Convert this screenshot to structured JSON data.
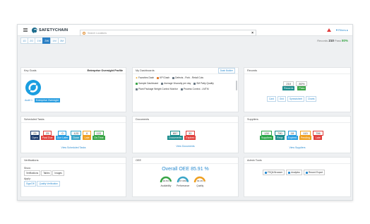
{
  "topbar": {
    "logo_text": "SAFETYCHAIN",
    "filters_label": "▼Filters ▸"
  },
  "ranges": [
    "1D",
    "2D",
    "1W",
    "2W",
    "1M",
    "3M"
  ],
  "active_range_index": 3,
  "records_summary": {
    "label": "Records",
    "count": "210",
    "pass_label": "Pass",
    "pass_value": "80%"
  },
  "search": {
    "placeholder": "Search Locations",
    "close_label": "×"
  },
  "key_goals": {
    "title": "Key Goals",
    "profile": "Enterprise Oversight Profile",
    "audit_label": "Audit 1",
    "badge_label": "Enterprise Oversight"
  },
  "dashboards": {
    "title": "My Dashboards",
    "open_builder": "Dash Builder",
    "items": [
      {
        "label": "Favorites Dash",
        "icon": "star-icon",
        "color": "#e8a21a"
      },
      {
        "label": "KPI Dash",
        "icon": "chart-icon",
        "color": "#e57b2c"
      },
      {
        "label": "Defects - Pork - Retail Cuts",
        "icon": "grid-icon",
        "color": "#6b7a86"
      },
      {
        "label": "Sample Dashboard",
        "icon": "grid-icon",
        "color": "#3aa648"
      },
      {
        "label": "Average Viscosity per day",
        "icon": "grid-icon",
        "color": "#6b7a86"
      },
      {
        "label": "SM Patty Quality",
        "icon": "grid-icon",
        "color": "#6b7a86"
      },
      {
        "label": "Plant Package Weight Control Monitor",
        "icon": "grid-icon",
        "color": "#6b7a86"
      },
      {
        "label": "Process Control - LMTM",
        "icon": "grid-icon",
        "color": "#6b7a86"
      }
    ]
  },
  "records": {
    "title": "Records",
    "count": "210",
    "pass_pct": "80%",
    "count_label": "Records",
    "pass_label": "Pass",
    "actions": [
      "Card",
      "Grid",
      "Spreadsheet",
      "Charts"
    ]
  },
  "scheduled_tasks": {
    "title": "Scheduled Tasks",
    "tiles": [
      {
        "value": "25",
        "label": "Open",
        "color": "#1d3c6e"
      },
      {
        "value": "25",
        "label": "Past Due",
        "color": "#e0403c"
      },
      {
        "value": "0",
        "label": "Due Later",
        "color": "#2a9ee0"
      },
      {
        "value": "123",
        "label": "Done",
        "color": "#3aa6c8"
      },
      {
        "value": "0",
        "label": "Late",
        "color": "#f0a020"
      },
      {
        "value": "122",
        "label": "On Time",
        "color": "#3aa648"
      }
    ],
    "view_link": "View Scheduled Tasks"
  },
  "documents": {
    "title": "Documents",
    "tiles": [
      {
        "value": "857",
        "label": "Documents",
        "color": "#1a8c8c"
      },
      {
        "value": "32",
        "label": "Expired",
        "color": "#e0403c"
      }
    ],
    "view_link": "View Documents"
  },
  "suppliers": {
    "title": "Suppliers",
    "tiles": [
      {
        "value": "130",
        "label": "Suppliers",
        "color": "#2aa648"
      },
      {
        "value": "790",
        "label": "Reqs",
        "color": "#1a8c8c"
      },
      {
        "value": "18",
        "label": "Expired",
        "color": "#2a9ee0"
      },
      {
        "value": "113",
        "label": "Pending",
        "color": "#f0a020"
      },
      {
        "value": "796",
        "label": "Late",
        "color": "#e0403c"
      }
    ],
    "view_link": "View Suppliers"
  },
  "verifications": {
    "title": "Verifications",
    "show_label": "Show:",
    "show_buttons": [
      "Verifications",
      "Tables",
      "Images"
    ],
    "apply_label": "Apply:",
    "apply_buttons": [
      "Sign/Off",
      "Quality Verification"
    ]
  },
  "oee": {
    "title": "OEE",
    "overall": "Overall OEE 85.91 %",
    "gauges": [
      {
        "value": "94.6%",
        "label": "Availability",
        "fraction": 0.946,
        "color": "#3aa648"
      },
      {
        "value": "97.09%",
        "label": "Performance",
        "fraction": 0.97,
        "color": "#3aa6c8"
      },
      {
        "value": "93.4%",
        "label": "Quality",
        "fraction": 0.934,
        "color": "#f0a020"
      }
    ]
  },
  "admin_tools": {
    "title": "Admin Tools",
    "buttons": [
      "FSQA Browser",
      "Analytics",
      "Record Export"
    ]
  }
}
